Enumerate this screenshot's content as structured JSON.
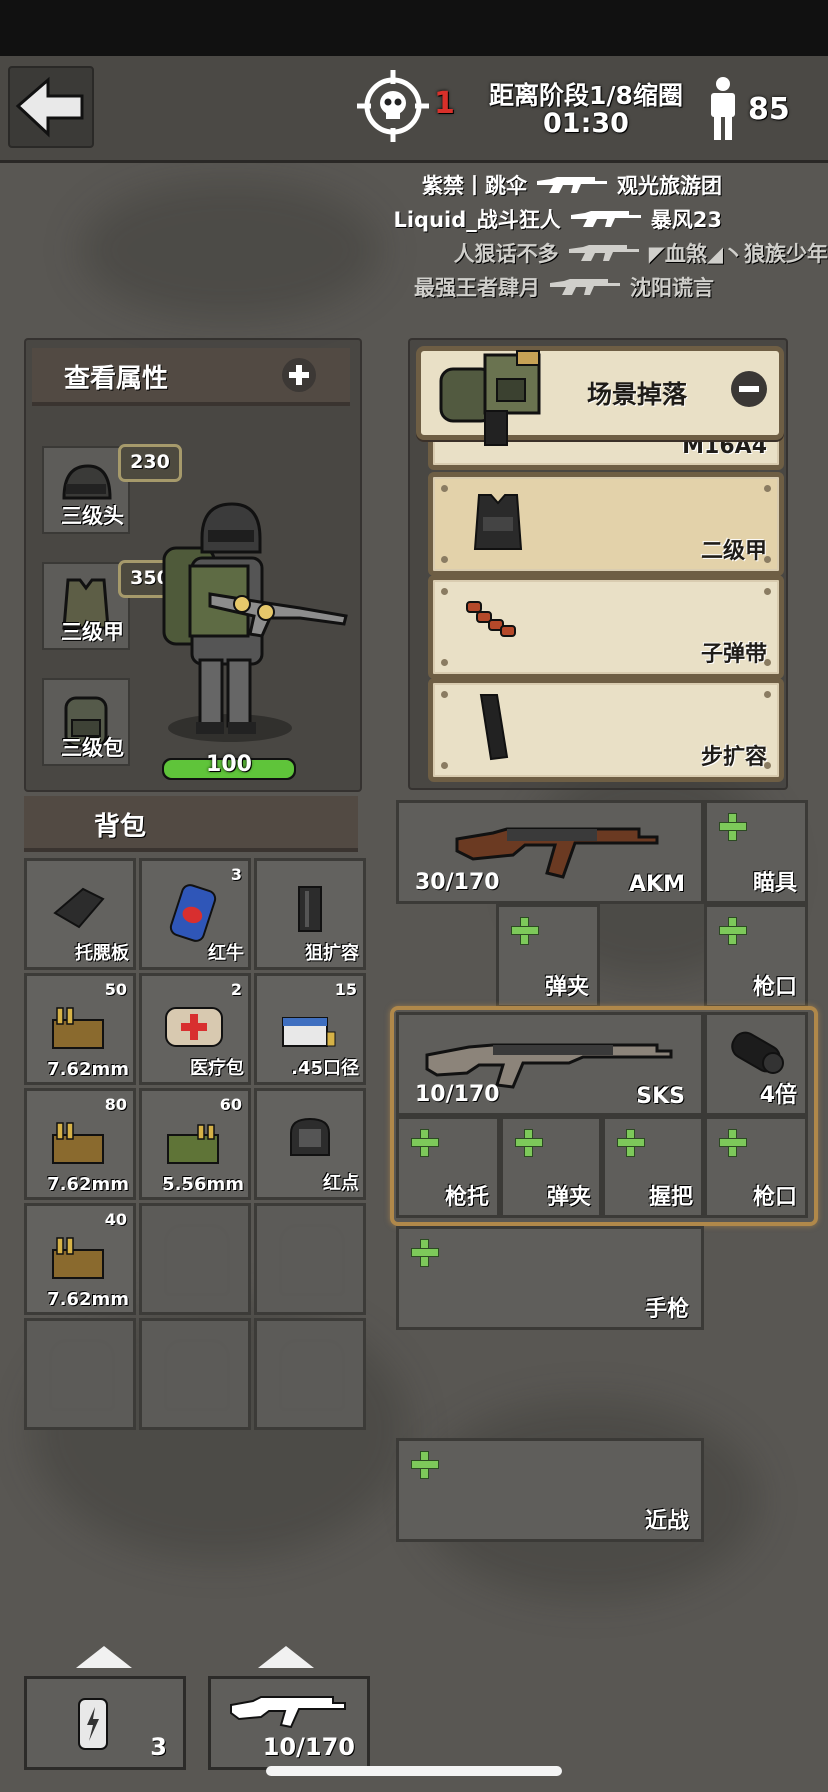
{
  "header": {
    "kills": "1",
    "phase_text": "距离阶段1/8缩圈",
    "timer": "01:30",
    "alive_count": "85"
  },
  "kill_feed": [
    {
      "killer": "紫禁丨跳伞",
      "victim": "观光旅游团",
      "dim": false
    },
    {
      "killer": "Liquid_战斗狂人",
      "victim": "暴风23",
      "dim": false
    },
    {
      "killer": "人狠话不多",
      "victim": "◤血煞◢丶狼族少年",
      "dim": true
    },
    {
      "killer": "最强王者肆月",
      "victim": "沈阳谎言",
      "dim": true
    }
  ],
  "attributes": {
    "title": "查看属性",
    "helmet": {
      "label": "三级头",
      "durability": "230"
    },
    "armor": {
      "label": "三级甲",
      "durability": "350"
    },
    "backpack": {
      "label": "三级包"
    },
    "health": "100"
  },
  "scene_drop": {
    "title": "场景掉落",
    "items": [
      {
        "label": "M16A4"
      },
      {
        "label": "二级甲"
      },
      {
        "label": "子弹带"
      },
      {
        "label": "步扩容"
      }
    ]
  },
  "bag": {
    "title": "背包",
    "items": [
      {
        "name": "托腮板",
        "count": ""
      },
      {
        "name": "红牛",
        "count": "3"
      },
      {
        "name": "狙扩容",
        "count": ""
      },
      {
        "name": "7.62mm",
        "count": "50"
      },
      {
        "name": "医疗包",
        "count": "2"
      },
      {
        "name": ".45口径",
        "count": "15"
      },
      {
        "name": "7.62mm",
        "count": "80"
      },
      {
        "name": "5.56mm",
        "count": "60"
      },
      {
        "name": "红点",
        "count": ""
      },
      {
        "name": "7.62mm",
        "count": "40"
      }
    ]
  },
  "weapons": {
    "primary1": {
      "name": "AKM",
      "ammo": "30/170",
      "scope": "瞄具",
      "magazine": "弹夹",
      "muzzle": "枪口"
    },
    "primary2": {
      "name": "SKS",
      "ammo": "10/170",
      "scope": "4倍",
      "stock": "枪托",
      "magazine": "弹夹",
      "grip": "握把",
      "muzzle": "枪口"
    },
    "pistol": "手枪",
    "melee": "近战"
  },
  "quickbar": {
    "drink_count": "3",
    "weapon_ammo": "10/170"
  },
  "colors": {
    "kill_red": "#d9302a",
    "health_green": "#5fc43a",
    "plus_green": "#7dc95a",
    "selected_border": "#b0884a"
  }
}
